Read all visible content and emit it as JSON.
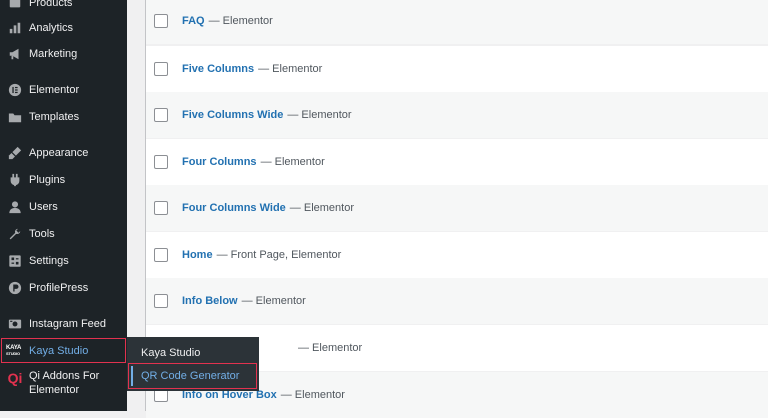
{
  "sidebar": {
    "items": [
      {
        "label": "Products",
        "icon": "products-icon"
      },
      {
        "label": "Analytics",
        "icon": "analytics-icon"
      },
      {
        "label": "Marketing",
        "icon": "marketing-icon"
      },
      {
        "label": "Elementor",
        "icon": "elementor-icon"
      },
      {
        "label": "Templates",
        "icon": "templates-icon"
      },
      {
        "label": "Appearance",
        "icon": "appearance-icon"
      },
      {
        "label": "Plugins",
        "icon": "plugins-icon"
      },
      {
        "label": "Users",
        "icon": "users-icon"
      },
      {
        "label": "Tools",
        "icon": "tools-icon"
      },
      {
        "label": "Settings",
        "icon": "settings-icon"
      },
      {
        "label": "ProfilePress",
        "icon": "profilepress-icon"
      },
      {
        "label": "Instagram Feed",
        "icon": "instagram-icon"
      },
      {
        "label": "Kaya Studio",
        "icon": "kaya-studio-logo",
        "logo_text_top": "KAYA",
        "logo_text_bottom": "STUDIO"
      },
      {
        "label": "Qi Addons For Elementor",
        "icon": "qi-icon",
        "icon_text": "Qi"
      }
    ]
  },
  "flyout": {
    "items": [
      {
        "label": "Kaya Studio"
      },
      {
        "label": "QR Code Generator"
      }
    ]
  },
  "rows": [
    {
      "title": "FAQ",
      "suffix": "— Elementor"
    },
    {
      "title": "Five Columns",
      "suffix": "— Elementor"
    },
    {
      "title": "Five Columns Wide",
      "suffix": "— Elementor"
    },
    {
      "title": "Four Columns",
      "suffix": "— Elementor"
    },
    {
      "title": "Four Columns Wide",
      "suffix": "— Elementor"
    },
    {
      "title": "Home",
      "suffix": "— Front Page, Elementor"
    },
    {
      "title": "Info Below",
      "suffix": "— Elementor"
    },
    {
      "title": "",
      "suffix": "— Elementor"
    },
    {
      "title": "Info on Hover Box",
      "suffix": "— Elementor"
    }
  ],
  "colors": {
    "sidebar_bg": "#1d2327",
    "flyout_bg": "#2c3338",
    "highlight": "#e2324f",
    "link": "#2271b1",
    "submenu_active": "#72aee6"
  }
}
